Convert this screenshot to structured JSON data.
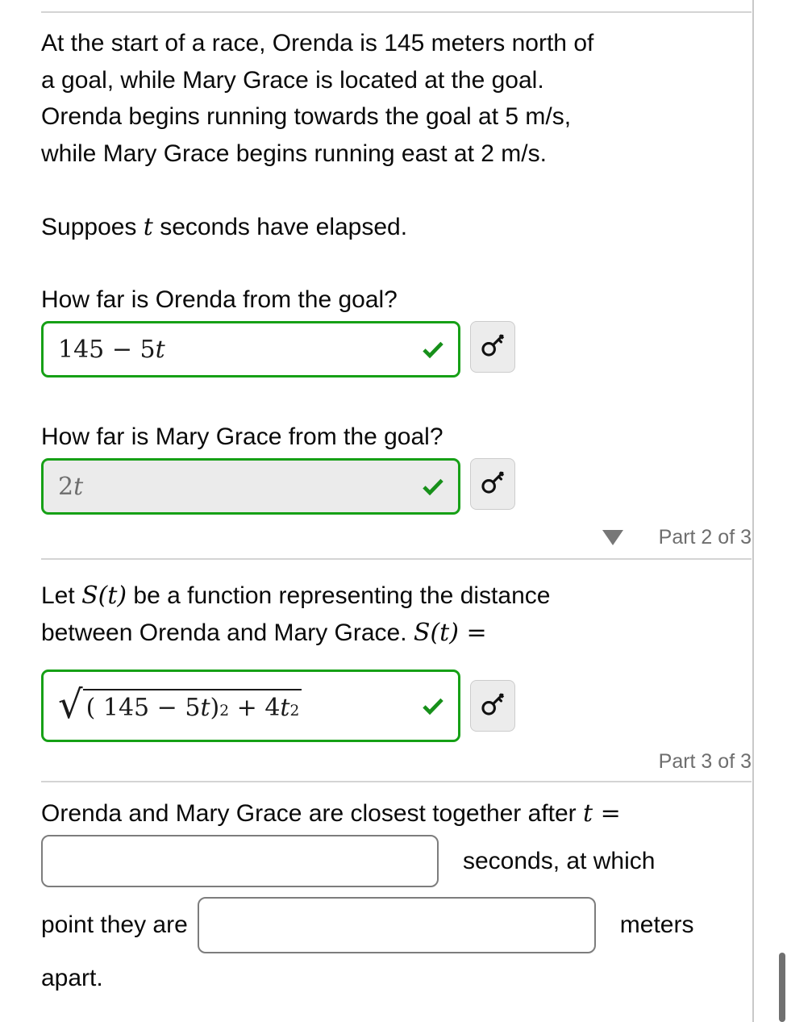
{
  "colors": {
    "correct_green": "#16a016",
    "divider_gray": "#d4d4d4",
    "part_label_gray": "#6e6e6e",
    "disabled_field_bg": "#ebebeb",
    "input_border_gray": "#7d7d7d",
    "key_button_bg": "#ececec"
  },
  "problem": {
    "paragraph_lines": [
      "At the start of a race, Orenda is 145 meters north of",
      "a goal, while Mary Grace is located at the goal.",
      "Orenda begins running towards the goal at 5 m/s,",
      "while Mary Grace begins running east at 2 m/s."
    ],
    "statement_plain": "At the start of a race, Orenda is 145 meters north of a goal, while Mary Grace is located at the goal. Orenda begins running towards the goal at 5 m/s, while Mary Grace begins running east at 2 m/s.",
    "distance_north": "145",
    "distance_unit": "meters",
    "orenda_speed": "5",
    "mary_grace_speed": "2",
    "speed_unit": "m/s"
  },
  "supposition": {
    "prefix": "Suppoes",
    "variable": "t",
    "suffix": "seconds have elapsed."
  },
  "part1": {
    "question_a": "How far is Orenda from the goal?",
    "answer_a": {
      "value_number": "145",
      "value_minus": "−",
      "value_coeff": "5",
      "value_var": "t",
      "state": "correct",
      "check_icon": "check-icon",
      "key_icon": "key-icon"
    },
    "question_b": "How far is Mary Grace from the goal?",
    "answer_b": {
      "value_coeff": "2",
      "value_var": "t",
      "state": "correct",
      "check_icon": "check-icon",
      "key_icon": "key-icon"
    },
    "footer": {
      "toggle_icon": "triangle-down-icon",
      "label": "Part 2 of 3"
    }
  },
  "part2": {
    "prompt_line1_pre": "Let",
    "prompt_func": "S(t)",
    "prompt_line1_post": "be a function representing the distance",
    "prompt_line2": "between Orenda and Mary Grace.",
    "prompt_line2_func": "S(t) =",
    "answer": {
      "radical": "√",
      "expr_text": "√( 145 − 5t )² + 4t²",
      "open_paren": "(",
      "inner_number": "145",
      "inner_minus": "−",
      "inner_coeff": "5",
      "inner_var": "t",
      "close_paren": ")",
      "paren_exponent": "2",
      "plus": "+",
      "second_coeff": "4",
      "second_var": "t",
      "second_exponent": "2",
      "state": "correct",
      "check_icon": "check-icon",
      "key_icon": "key-icon"
    },
    "footer": {
      "label": "Part 3 of 3"
    }
  },
  "part3": {
    "line1_text": "Orenda and Mary Grace are closest together after",
    "line1_var": "t =",
    "time_input": {
      "value": "",
      "placeholder": ""
    },
    "after_time_text": "seconds, at which",
    "line2_prefix": "point they are",
    "distance_input": {
      "value": "",
      "placeholder": ""
    },
    "after_distance_text": "meters",
    "line3_text": "apart."
  }
}
